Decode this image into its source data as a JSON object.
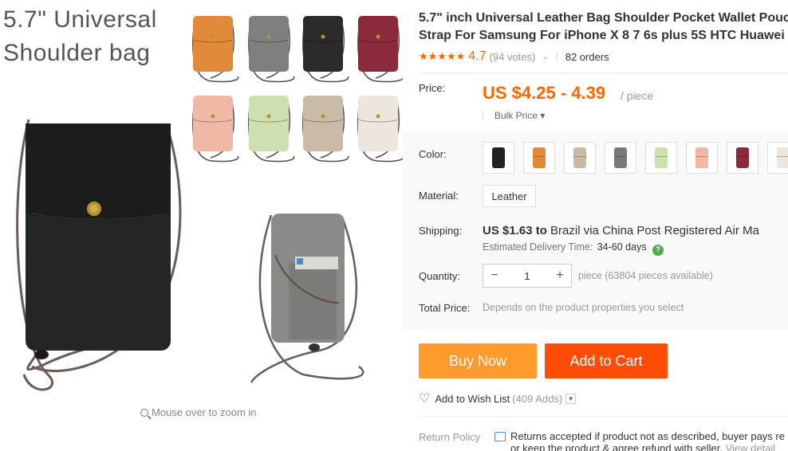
{
  "gallery": {
    "banner_line1": "5.7\" Universal",
    "banner_line2": "Shoulder bag",
    "zoom_hint": "Mouse over to zoom in",
    "thumb_colors": [
      "#e08a3a",
      "#7f7f7f",
      "#2b2b2b",
      "#8b2a3a",
      "#efb9a5",
      "#cfe0b0",
      "#c9bba5",
      "#ece6dc"
    ],
    "main_bag_color": "#252525",
    "second_bag_color": "#8a8a88"
  },
  "product": {
    "title_line1": "5.7\" inch Universal Leather Bag Shoulder Pocket Wallet Pouch",
    "title_line2": "Strap For Samsung For iPhone X 8 7 6s plus 5S HTC Huawei",
    "stars": "★★★★★",
    "rating": "4.7",
    "votes": "(94 votes)",
    "orders": "82 orders"
  },
  "price": {
    "label": "Price:",
    "value": "US $4.25 - 4.39",
    "unit": "/ piece",
    "bulk": "Bulk Price ▾"
  },
  "color": {
    "label": "Color:",
    "swatches": [
      "#222222",
      "#e08a3a",
      "#c9bba5",
      "#7a7a7a",
      "#cfe0b0",
      "#efb9a5",
      "#8b2a3a",
      "#ece6dc"
    ]
  },
  "material": {
    "label": "Material:",
    "value": "Leather"
  },
  "shipping": {
    "label": "Shipping:",
    "cost": "US $1.63 to",
    "dest": "Brazil via China Post Registered Air Ma",
    "est_label": "Estimated Delivery Time:",
    "est_days": "34-60 days",
    "help": "?"
  },
  "quantity": {
    "label": "Quantity:",
    "minus": "−",
    "value": "1",
    "plus": "+",
    "available": "piece (63804 pieces available)"
  },
  "total": {
    "label": "Total Price:",
    "value": "Depends on the product properties you select"
  },
  "actions": {
    "buy_now": "Buy Now",
    "add_cart": "Add to Cart",
    "wish_heart": "♡",
    "wish_label": "Add to Wish List",
    "wish_count": "(409 Adds)",
    "wish_dd": "▼"
  },
  "returns": {
    "label": "Return Policy",
    "line1": "Returns accepted if product not as described, buyer pays re",
    "line2": "or keep the product & agree refund with seller.",
    "link": "View detail"
  }
}
